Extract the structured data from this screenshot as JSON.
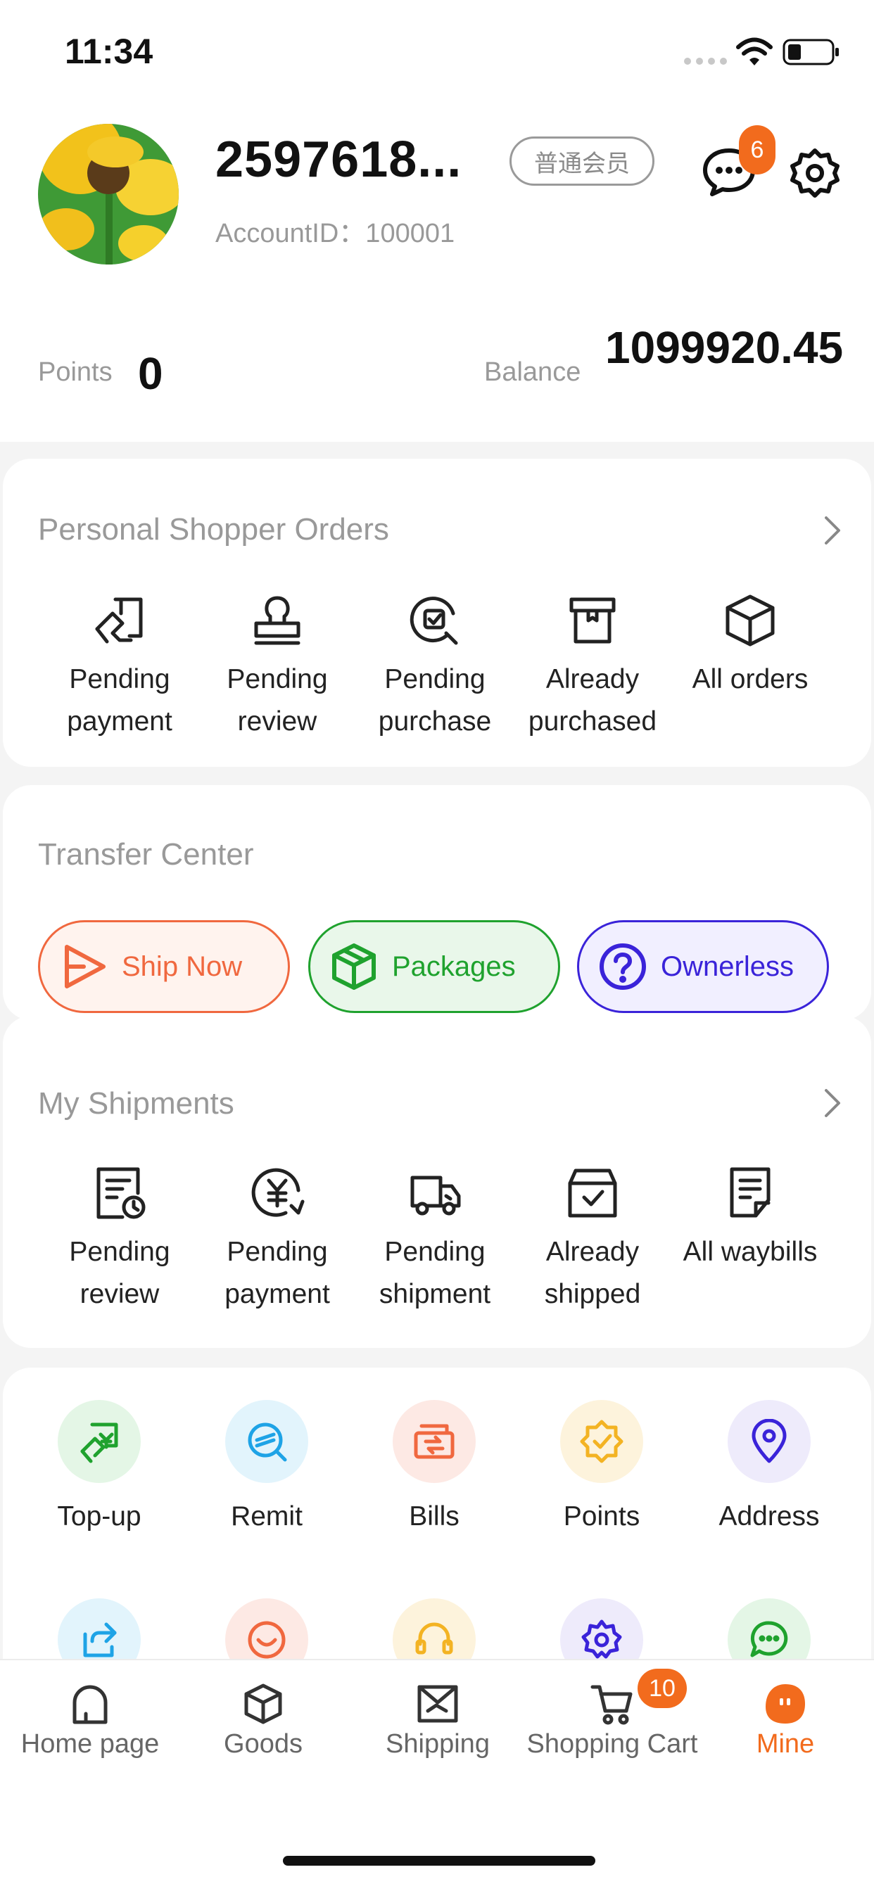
{
  "status_bar": {
    "time": "11:34"
  },
  "profile": {
    "username": "2597618...",
    "member_level": "普通会员",
    "account_id": "AccountID：100001",
    "message_count": "6"
  },
  "stats": {
    "points_label": "Points",
    "points_value": "0",
    "balance_label": "Balance",
    "balance_value": "1099920.45"
  },
  "personal_shopper": {
    "title": "Personal Shopper Orders",
    "items": [
      {
        "label": "Pending payment",
        "icon": "hand-card-icon"
      },
      {
        "label": "Pending review",
        "icon": "stamp-icon"
      },
      {
        "label": "Pending purchase",
        "icon": "search-check-icon"
      },
      {
        "label": "Already purchased",
        "icon": "archive-box-icon"
      },
      {
        "label": "All orders",
        "icon": "cube-icon"
      }
    ]
  },
  "transfer_center": {
    "title": "Transfer Center",
    "buttons": [
      {
        "label": "Ship Now",
        "color": "#f0683f",
        "bg": "#fff3ee"
      },
      {
        "label": "Packages",
        "color": "#1fa22e",
        "bg": "#e9f7ea"
      },
      {
        "label": "Ownerless",
        "color": "#3a23d9",
        "bg": "#f1efff"
      }
    ]
  },
  "my_shipments": {
    "title": "My Shipments",
    "items": [
      {
        "label": "Pending review",
        "icon": "document-clock-icon"
      },
      {
        "label": "Pending payment",
        "icon": "yen-refresh-icon"
      },
      {
        "label": "Pending shipment",
        "icon": "truck-icon"
      },
      {
        "label": "Already shipped",
        "icon": "box-check-icon"
      },
      {
        "label": "All waybills",
        "icon": "waybill-icon"
      }
    ]
  },
  "quick_actions": [
    {
      "label": "Top-up",
      "color": "#1fa22e",
      "bg": "#e4f6e6"
    },
    {
      "label": "Remit",
      "color": "#1ea3e6",
      "bg": "#e2f4fc"
    },
    {
      "label": "Bills",
      "color": "#f0683f",
      "bg": "#fde9e4"
    },
    {
      "label": "Points",
      "color": "#f3b323",
      "bg": "#fdf3dc"
    },
    {
      "label": "Address",
      "color": "#3a23d9",
      "bg": "#eeebfb"
    }
  ],
  "tabbar": {
    "items": [
      {
        "label": "Home page"
      },
      {
        "label": "Goods"
      },
      {
        "label": "Shipping"
      },
      {
        "label": "Shopping Cart"
      },
      {
        "label": "Mine"
      }
    ],
    "cart_count": "10",
    "active_color": "#f26b1d"
  }
}
